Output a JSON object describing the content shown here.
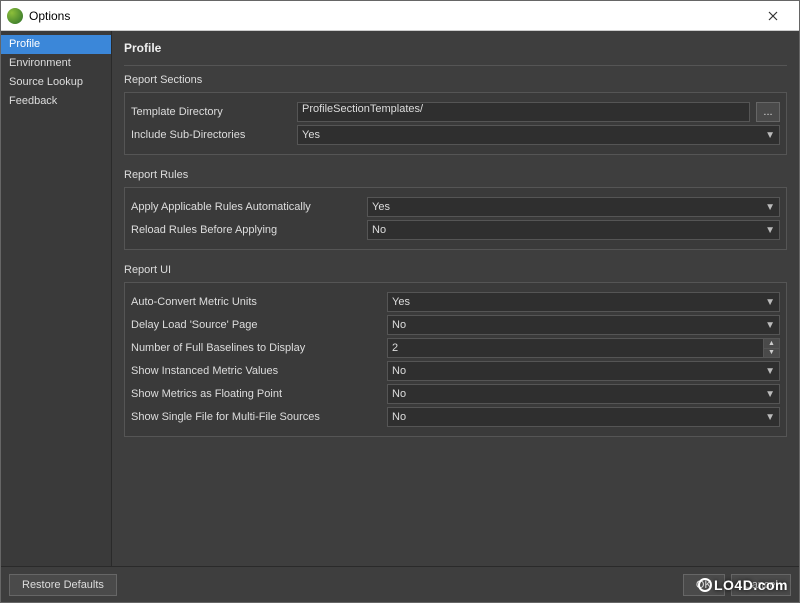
{
  "window": {
    "title": "Options"
  },
  "sidebar": {
    "items": [
      {
        "label": "Profile",
        "active": true
      },
      {
        "label": "Environment"
      },
      {
        "label": "Source Lookup"
      },
      {
        "label": "Feedback"
      }
    ]
  },
  "page": {
    "title": "Profile",
    "groups": {
      "report_sections": {
        "title": "Report Sections",
        "template_directory": {
          "label": "Template Directory",
          "value": "ProfileSectionTemplates/",
          "browse": "..."
        },
        "include_sub": {
          "label": "Include Sub-Directories",
          "value": "Yes"
        }
      },
      "report_rules": {
        "title": "Report Rules",
        "apply_auto": {
          "label": "Apply Applicable Rules Automatically",
          "value": "Yes"
        },
        "reload_before": {
          "label": "Reload Rules Before Applying",
          "value": "No"
        }
      },
      "report_ui": {
        "title": "Report UI",
        "auto_convert": {
          "label": "Auto-Convert Metric Units",
          "value": "Yes"
        },
        "delay_load": {
          "label": "Delay Load 'Source' Page",
          "value": "No"
        },
        "baselines": {
          "label": "Number of Full Baselines to Display",
          "value": "2"
        },
        "show_instanced": {
          "label": "Show Instanced Metric Values",
          "value": "No"
        },
        "show_float": {
          "label": "Show Metrics as Floating Point",
          "value": "No"
        },
        "show_single_file": {
          "label": "Show Single File for Multi-File Sources",
          "value": "No"
        }
      }
    }
  },
  "footer": {
    "restore": "Restore Defaults",
    "ok": "OK",
    "cancel": "Cancel"
  },
  "watermark": "LO4D.com"
}
